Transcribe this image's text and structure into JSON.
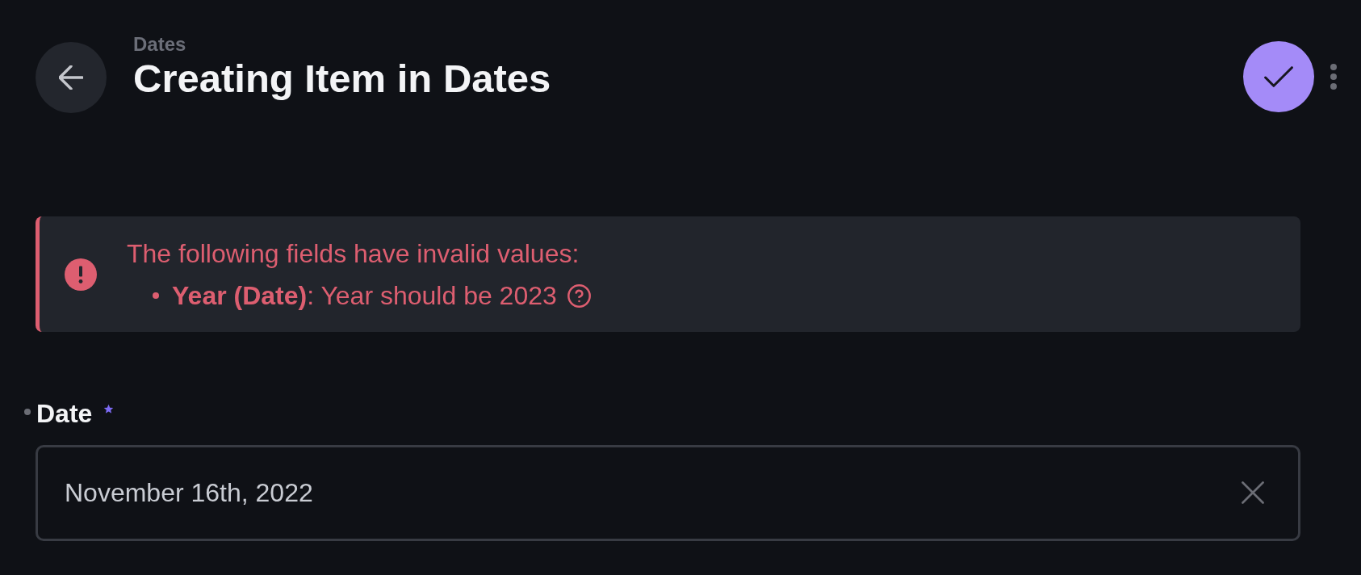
{
  "header": {
    "breadcrumb": "Dates",
    "title": "Creating Item in Dates"
  },
  "notice": {
    "heading": "The following fields have invalid values:",
    "errors": [
      {
        "text": "**Year (Date)**: Year should be 2023"
      }
    ]
  },
  "fields": [
    {
      "label": "Date",
      "required": true,
      "edited": true,
      "value": "November 16th, 2022"
    }
  ]
}
